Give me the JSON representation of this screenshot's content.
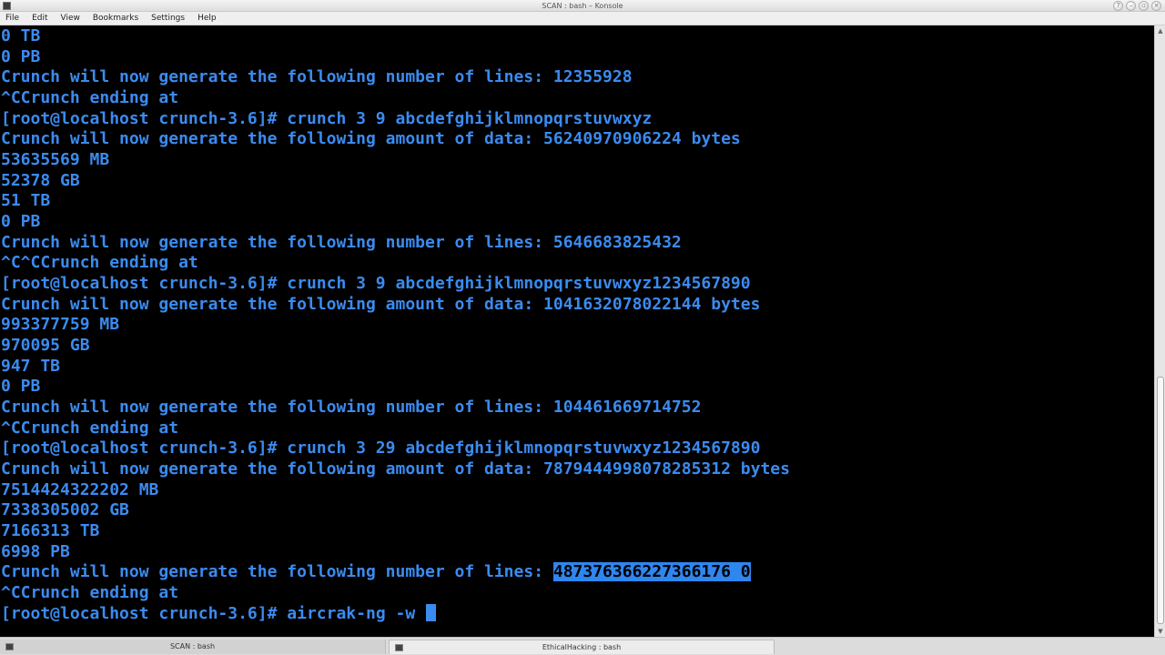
{
  "window": {
    "title": "SCAN : bash – Konsole"
  },
  "menubar": {
    "items": [
      "File",
      "Edit",
      "View",
      "Bookmarks",
      "Settings",
      "Help"
    ]
  },
  "terminal": {
    "lines": [
      "0 TB",
      "0 PB",
      "Crunch will now generate the following number of lines: 12355928",
      "^CCrunch ending at",
      "[root@localhost crunch-3.6]# crunch 3 9 abcdefghijklmnopqrstuvwxyz",
      "Crunch will now generate the following amount of data: 56240970906224 bytes",
      "53635569 MB",
      "52378 GB",
      "51 TB",
      "0 PB",
      "Crunch will now generate the following number of lines: 5646683825432",
      "^C^CCrunch ending at",
      "[root@localhost crunch-3.6]# crunch 3 9 abcdefghijklmnopqrstuvwxyz1234567890",
      "Crunch will now generate the following amount of data: 1041632078022144 bytes",
      "993377759 MB",
      "970095 GB",
      "947 TB",
      "0 PB",
      "Crunch will now generate the following number of lines: 104461669714752",
      "^CCrunch ending at",
      "[root@localhost crunch-3.6]# crunch 3 29 abcdefghijklmnopqrstuvwxyz1234567890",
      "Crunch will now generate the following amount of data: 7879444998078285312 bytes",
      "7514424322202 MB",
      "7338305002 GB",
      "7166313 TB",
      "6998 PB"
    ],
    "selected_line_prefix": "Crunch will now generate the following number of lines: ",
    "selected_text": "487376366227366176 0",
    "after_selection_lines": [
      "^CCrunch ending at"
    ],
    "prompt": "[root@localhost crunch-3.6]# ",
    "current_input": "aircrak-ng -w "
  },
  "tabs": [
    {
      "label": "SCAN : bash",
      "active": false
    },
    {
      "label": "EthicalHacking : bash",
      "active": true
    }
  ],
  "colors": {
    "terminal_bg": "#000000",
    "terminal_fg": "#3b8bef",
    "selection_bg": "#2f86ef"
  }
}
